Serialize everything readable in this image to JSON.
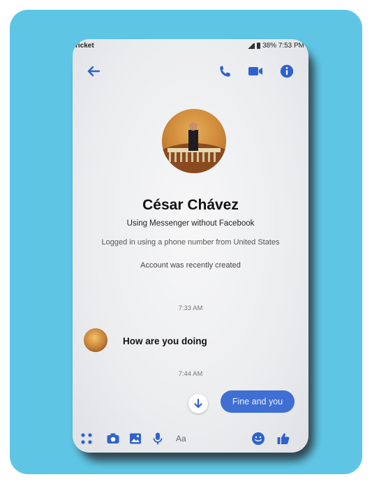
{
  "status_bar": {
    "carrier": "ricket",
    "right": "38% 7:53 PM"
  },
  "conversation": {
    "contact_name": "César Chávez",
    "subtitle": "Using Messenger without Facebook",
    "logged_in_note": "Logged in using a phone number from United States",
    "account_note": "Account was recently created"
  },
  "messages": [
    {
      "timestamp": "7:33 AM",
      "direction": "incoming",
      "text": "How are you doing"
    },
    {
      "timestamp": "7:44 AM",
      "direction": "outgoing",
      "text": "Fine and you"
    }
  ],
  "composer": {
    "placeholder": "Aa"
  },
  "icons": {
    "back": "back-arrow-icon",
    "call": "phone-icon",
    "video": "video-camera-icon",
    "info": "info-icon",
    "apps": "grid-icon",
    "camera": "camera-icon",
    "gallery": "image-icon",
    "mic": "microphone-icon",
    "emoji": "smile-icon",
    "like": "thumbs-up-icon",
    "scroll_down": "down-arrow-icon"
  },
  "colors": {
    "frame_background": "#5ec6e4",
    "accent": "#2f62cf",
    "outgoing_bubble": "#3f6fd2"
  }
}
